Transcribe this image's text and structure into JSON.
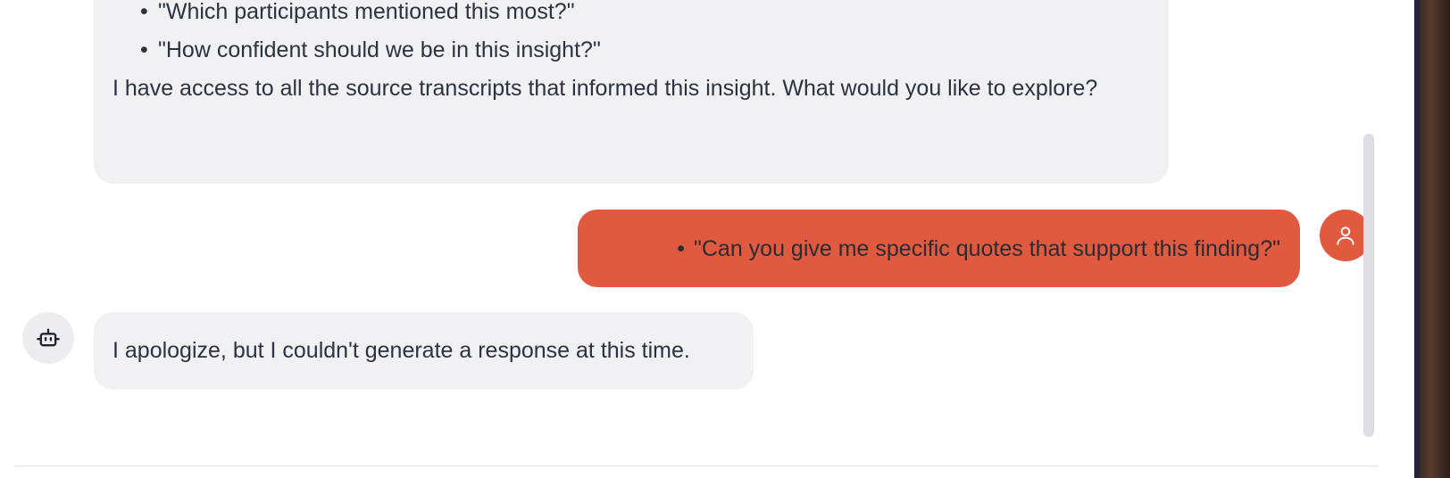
{
  "chat": {
    "assistant_top": {
      "bullets": [
        "\"Which participants mentioned this most?\"",
        "\"How confident should we be in this insight?\""
      ],
      "paragraph": "I have access to all the source transcripts that informed this insight. What would you like to explore?"
    },
    "user_message": {
      "bullet": "\"Can you give me specific quotes that support this finding?\""
    },
    "assistant_bottom": {
      "text": "I apologize, but I couldn't generate a response at this time."
    }
  },
  "avatars": {
    "user_icon": "user-icon",
    "bot_icon": "robot-icon"
  },
  "colors": {
    "assistant_bubble": "#f1f1f3",
    "user_bubble": "#e05a40",
    "text": "#2b3240",
    "scrollbar": "#dedde3"
  }
}
